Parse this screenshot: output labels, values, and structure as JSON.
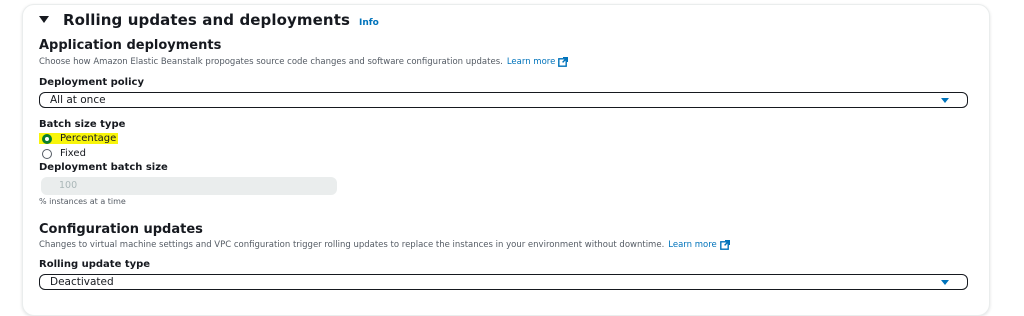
{
  "section": {
    "title": "Rolling updates and deployments",
    "info_label": "Info"
  },
  "application_deployments": {
    "heading": "Application deployments",
    "description": "Choose how Amazon Elastic Beanstalk propogates source code changes and software configuration updates.",
    "learn_more": "Learn more",
    "deployment_policy": {
      "label": "Deployment policy",
      "value": "All at once"
    },
    "batch_size_type": {
      "label": "Batch size type",
      "options": [
        {
          "label": "Percentage",
          "selected": true
        },
        {
          "label": "Fixed",
          "selected": false
        }
      ]
    },
    "deployment_batch_size": {
      "label": "Deployment batch size",
      "value": "100",
      "hint": "% instances at a time"
    }
  },
  "configuration_updates": {
    "heading": "Configuration updates",
    "description": "Changes to virtual machine settings and VPC configuration trigger rolling updates to replace the instances in your environment without downtime.",
    "learn_more": "Learn more",
    "rolling_update_type": {
      "label": "Rolling update type",
      "value": "Deactivated"
    }
  },
  "colors": {
    "link": "#0073bb",
    "highlight": "#f8f50a",
    "radio_checked": "#0a7d2c"
  },
  "icons": [
    "caret-down-icon",
    "info-link",
    "external-link-icon",
    "dropdown-caret-icon",
    "radio-icon"
  ]
}
